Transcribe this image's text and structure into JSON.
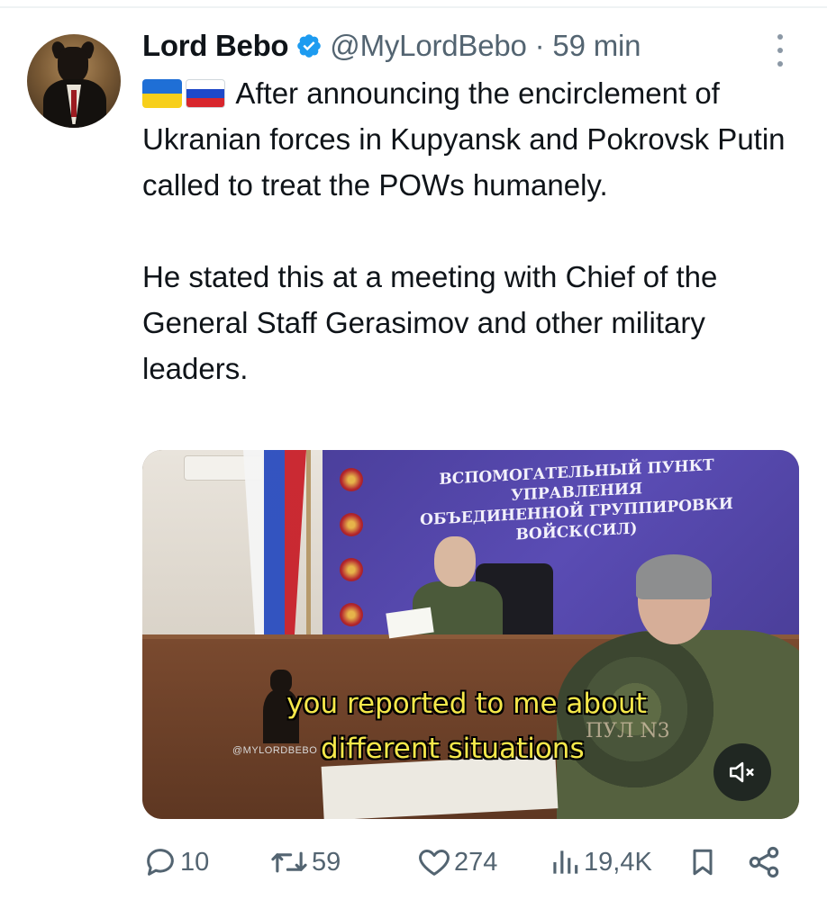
{
  "tweet": {
    "author_name": "Lord Bebo",
    "handle_time": "@MyLordBebo · 59 min",
    "flags": [
      "ukraine-flag-icon",
      "russia-flag-icon"
    ],
    "paragraph1": "After announcing the encirclement of Ukranian forces in Kupyansk and Pokrovsk Putin called to treat the POWs humanely.",
    "paragraph2": "He stated this at a meeting with Chief of the General Staff Gerasimov and other military leaders."
  },
  "media": {
    "banner_line1": "ВСПОМОГАТЕЛЬНЫЙ ПУНКТ УПРАВЛЕНИЯ",
    "banner_line2": "ОБЪЕДИНЕННОЙ ГРУППИРОВКИ ВОЙСК(СИЛ)",
    "caption_line1": "you reported to me about",
    "caption_line2": "different situations",
    "watermark": "@MYLORDBEBO",
    "pool_label": "ПУЛ N3"
  },
  "actions": {
    "replies": "10",
    "reposts": "59",
    "likes": "274",
    "views": "19,4K"
  },
  "colors": {
    "text": "#0f1419",
    "secondary": "#536471",
    "verified": "#1d9bf0",
    "caption": "#f5e84a"
  }
}
